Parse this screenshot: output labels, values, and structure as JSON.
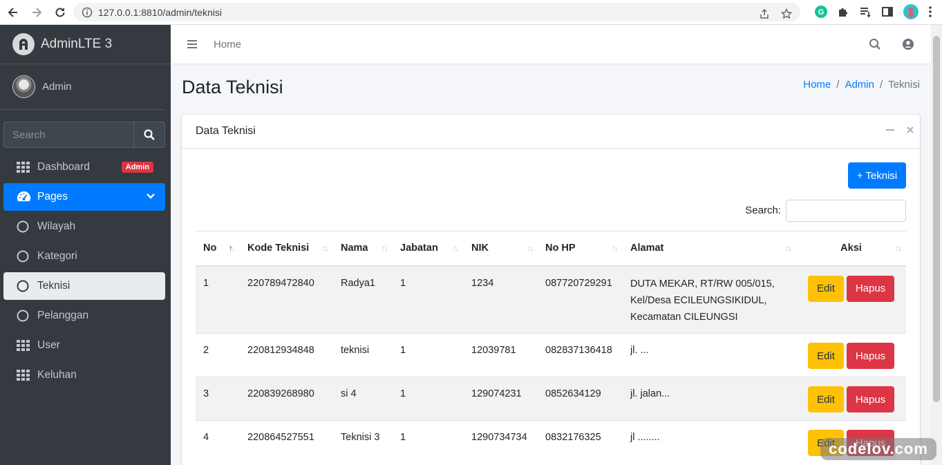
{
  "browser": {
    "url": "127.0.0.1:8810/admin/teknisi"
  },
  "sidebar": {
    "brand": "AdminLTE 3",
    "user": "Admin",
    "search_placeholder": "Search",
    "items": [
      {
        "label": "Dashboard",
        "icon": "grid-icon",
        "badge": "Admin"
      },
      {
        "label": "Pages",
        "icon": "gauge-icon"
      },
      {
        "label": "Wilayah",
        "icon": "circle-icon"
      },
      {
        "label": "Kategori",
        "icon": "circle-icon"
      },
      {
        "label": "Teknisi",
        "icon": "circle-icon"
      },
      {
        "label": "Pelanggan",
        "icon": "circle-icon"
      },
      {
        "label": "User",
        "icon": "grid-icon"
      },
      {
        "label": "Keluhan",
        "icon": "grid-icon"
      }
    ]
  },
  "navbar": {
    "home": "Home"
  },
  "page": {
    "title": "Data Teknisi",
    "breadcrumb": [
      "Home",
      "Admin",
      "Teknisi"
    ]
  },
  "card": {
    "title": "Data Teknisi",
    "add_button": "+ Teknisi",
    "search_label": "Search:"
  },
  "table": {
    "columns": [
      "No",
      "Kode Teknisi",
      "Nama",
      "Jabatan",
      "NIK",
      "No HP",
      "Alamat",
      "Aksi"
    ],
    "rows": [
      {
        "no": "1",
        "kode": "220789472840",
        "nama": "Radya1",
        "jabatan": "1",
        "nik": "1234",
        "hp": "087720729291",
        "alamat": [
          "DUTA MEKAR, RT/RW 005/015,",
          "Kel/Desa ECILEUNGSIKIDUL,",
          "Kecamatan CILEUNGSI"
        ]
      },
      {
        "no": "2",
        "kode": "220812934848",
        "nama": "teknisi",
        "jabatan": "1",
        "nik": "12039781",
        "hp": "082837136418",
        "alamat": [
          "jl. ..."
        ]
      },
      {
        "no": "3",
        "kode": "220839268980",
        "nama": "si 4",
        "jabatan": "1",
        "nik": "129074231",
        "hp": "0852634129",
        "alamat": [
          "jl. jalan..."
        ]
      },
      {
        "no": "4",
        "kode": "220864527551",
        "nama": "Teknisi 3",
        "jabatan": "1",
        "nik": "1290734734",
        "hp": "0832176325",
        "alamat": [
          "jl ........"
        ]
      }
    ],
    "edit_label": "Edit",
    "delete_label": "Hapus"
  },
  "watermark": "codelov.com",
  "colors": {
    "primary": "#007bff",
    "danger": "#dc3545",
    "warning": "#ffc107",
    "sidebar": "#343a40"
  }
}
